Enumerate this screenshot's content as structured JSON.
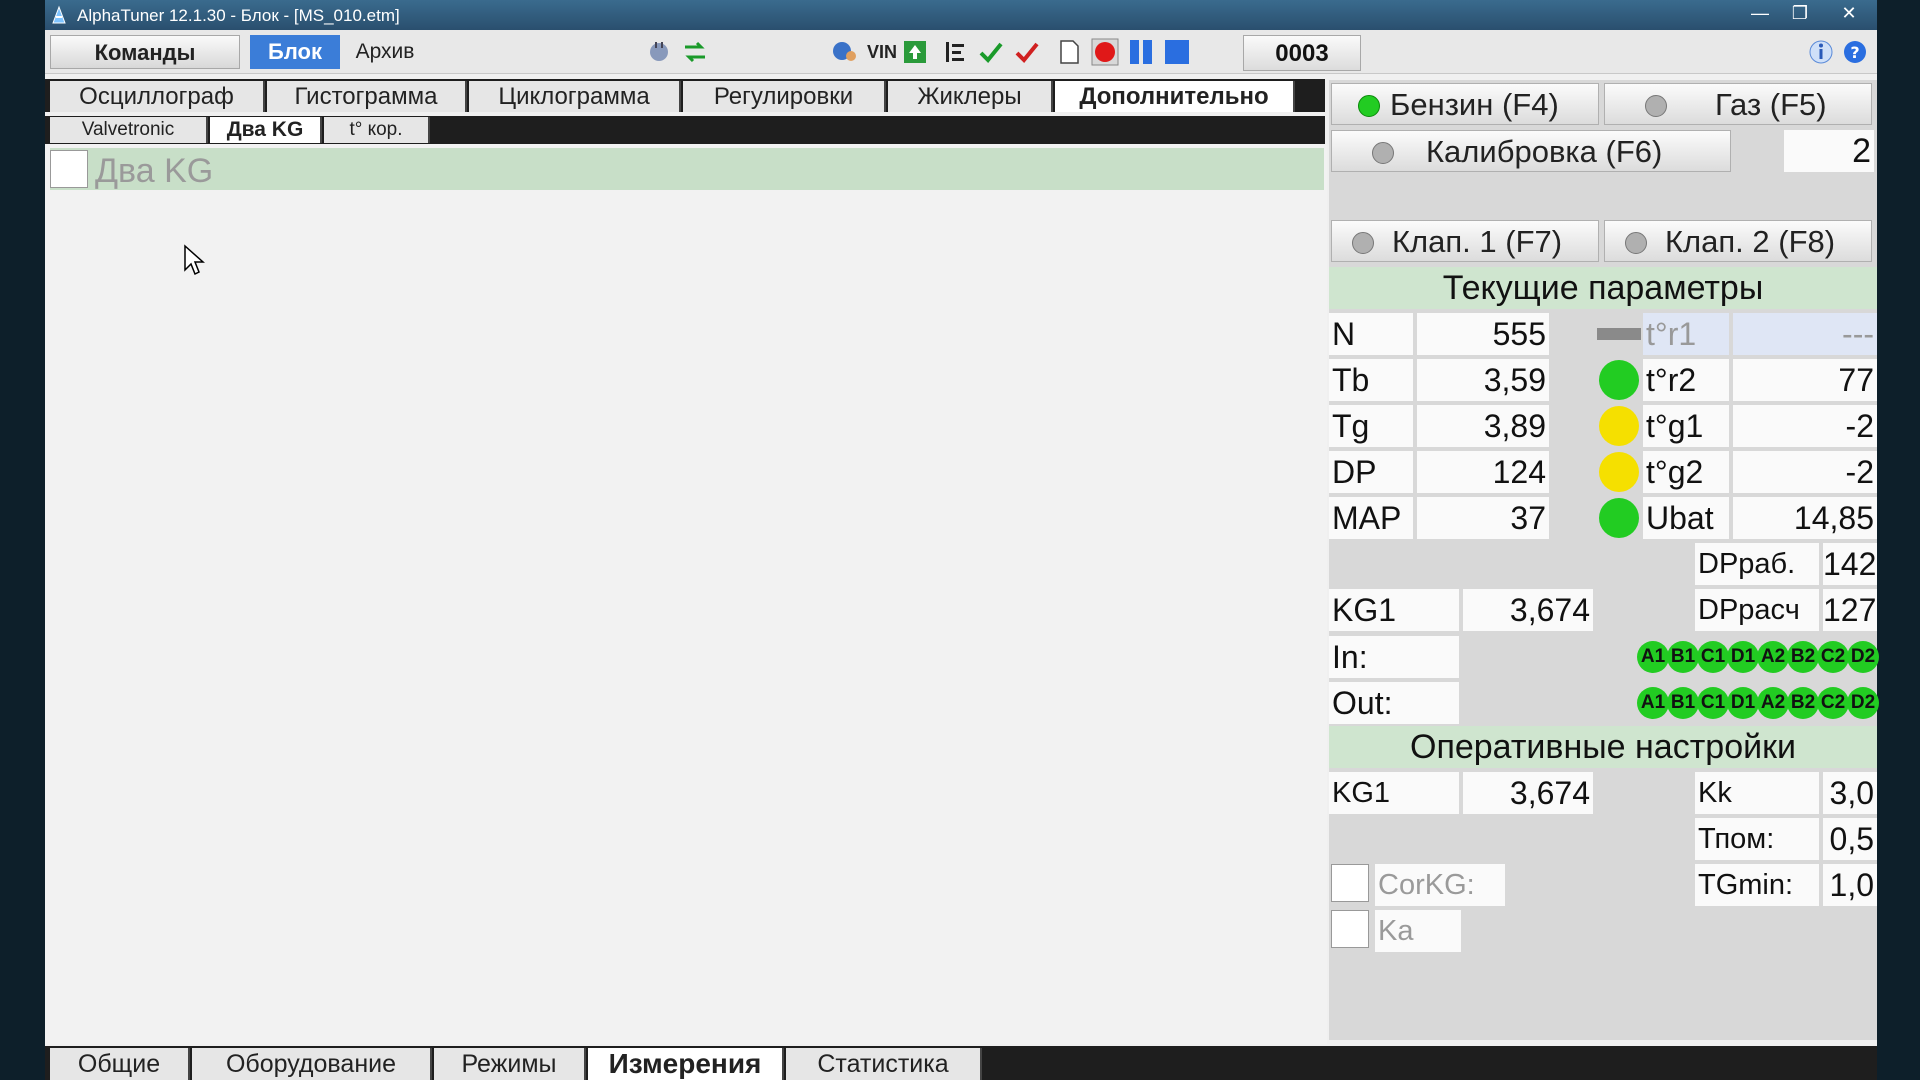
{
  "window": {
    "title": "AlphaTuner 12.1.30 - Блок - [MS_010.etm]",
    "controls": [
      "minimize-icon",
      "restore-icon",
      "close-icon"
    ]
  },
  "toolbar": {
    "commands": "Команды",
    "block": "Блок",
    "archive": "Архив",
    "vin": "VIN",
    "counter": "0003",
    "icons": [
      "plug-icon",
      "swap-arrows-icon",
      "globe-person-icon",
      "vin-icon",
      "upload-icon",
      "list-icon",
      "check-icon",
      "check-red-icon",
      "page-icon",
      "record-icon",
      "pause-icon",
      "stop-icon",
      "info-icon",
      "help-icon"
    ],
    "accent": "#3b7dd8"
  },
  "tabs": [
    {
      "label": "Осциллограф"
    },
    {
      "label": "Гистограмма"
    },
    {
      "label": "Циклограмма"
    },
    {
      "label": "Регулировки"
    },
    {
      "label": "Жиклеры"
    },
    {
      "label": "Дополнительно",
      "active": true
    }
  ],
  "subtabs": [
    {
      "label": "Valvetronic"
    },
    {
      "label": "Два KG",
      "active": true
    },
    {
      "label": "t° кор."
    }
  ],
  "content": {
    "checkbox_label": "Два KG",
    "checked": false
  },
  "modes": {
    "petrol": {
      "label": "Бензин (F4)",
      "state": "on",
      "color": "#22cc22"
    },
    "gas": {
      "label": "Газ (F5)",
      "state": "off"
    },
    "calibration": {
      "label": "Калибровка (F6)",
      "state": "off"
    },
    "calibration_value": "2",
    "valve1": {
      "label": "Клап. 1 (F7)",
      "state": "off"
    },
    "valve2": {
      "label": "Клап. 2 (F8)",
      "state": "off"
    }
  },
  "current": {
    "title": "Текущие параметры",
    "left": [
      {
        "name": "N",
        "value": "555"
      },
      {
        "name": "Tb",
        "value": "3,59"
      },
      {
        "name": "Tg",
        "value": "3,89"
      },
      {
        "name": "DP",
        "value": "124"
      },
      {
        "name": "MAP",
        "value": "37"
      }
    ],
    "right": [
      {
        "name": "t°r1",
        "value": "---",
        "indicator": "gray"
      },
      {
        "name": "t°r2",
        "value": "77",
        "indicator": "green"
      },
      {
        "name": "t°g1",
        "value": "-2",
        "indicator": "yellow"
      },
      {
        "name": "t°g2",
        "value": "-2",
        "indicator": "yellow"
      },
      {
        "name": "Ubat",
        "value": "14,85",
        "indicator": "green"
      }
    ],
    "dp_work_label": "DPраб.",
    "dp_work_value": "142",
    "dp_calc_label": "DPрасч",
    "dp_calc_value": "127",
    "kg1_label": "KG1",
    "kg1_value": "3,674",
    "in_label": "In:",
    "out_label": "Out:",
    "injectors": [
      "A1",
      "B1",
      "C1",
      "D1",
      "A2",
      "B2",
      "C2",
      "D2"
    ]
  },
  "operative": {
    "title": "Оперативные настройки",
    "kg1_label": "KG1",
    "kg1_value": "3,674",
    "kk_label": "Kk",
    "kk_value": "3,0",
    "tpom_label": "Тпом:",
    "tpom_value": "0,5",
    "tgmin_label": "TGmin:",
    "tgmin_value": "1,0",
    "corkg_label": "CorKG:",
    "ka_label": "Ka"
  },
  "bottom_tabs": [
    {
      "label": "Общие"
    },
    {
      "label": "Оборудование"
    },
    {
      "label": "Режимы"
    },
    {
      "label": "Измерения",
      "active": true
    },
    {
      "label": "Статистика"
    }
  ],
  "colors": {
    "green": "#22cc22",
    "yellow": "#f5e000",
    "gray": "#8a8a8a",
    "section": "#cfe5cf"
  }
}
